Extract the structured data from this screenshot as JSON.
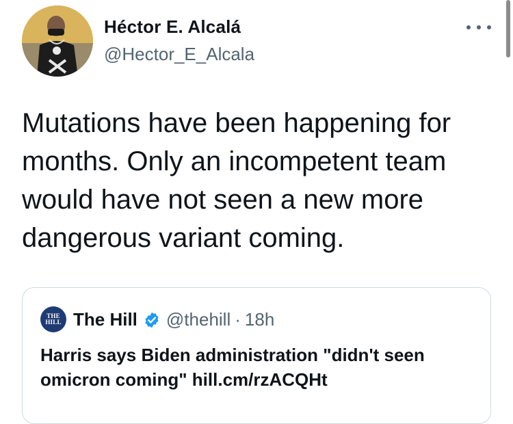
{
  "author": {
    "name": "Héctor E. Alcalá",
    "handle": "@Hector_E_Alcala"
  },
  "tweet": {
    "text": "Mutations have been happening for\nmonths. Only an incompetent team\nwould have not seen a new more\ndangerous variant coming."
  },
  "quoted": {
    "logo_text": "THE HILL",
    "name": "The Hill",
    "handle": "@thehill",
    "separator": "·",
    "time": "18h",
    "text": "Harris says Biden administration \"didn't seen omicron coming\" hill.cm/rzACQHt"
  },
  "icons": {
    "more": "more-horizontal-icon",
    "verified": "verified-badge-icon"
  },
  "colors": {
    "text": "#0f1419",
    "secondary": "#536471",
    "verified": "#1d9bf0",
    "border": "#cfd9de",
    "hill_logo": "#1f3b73"
  }
}
